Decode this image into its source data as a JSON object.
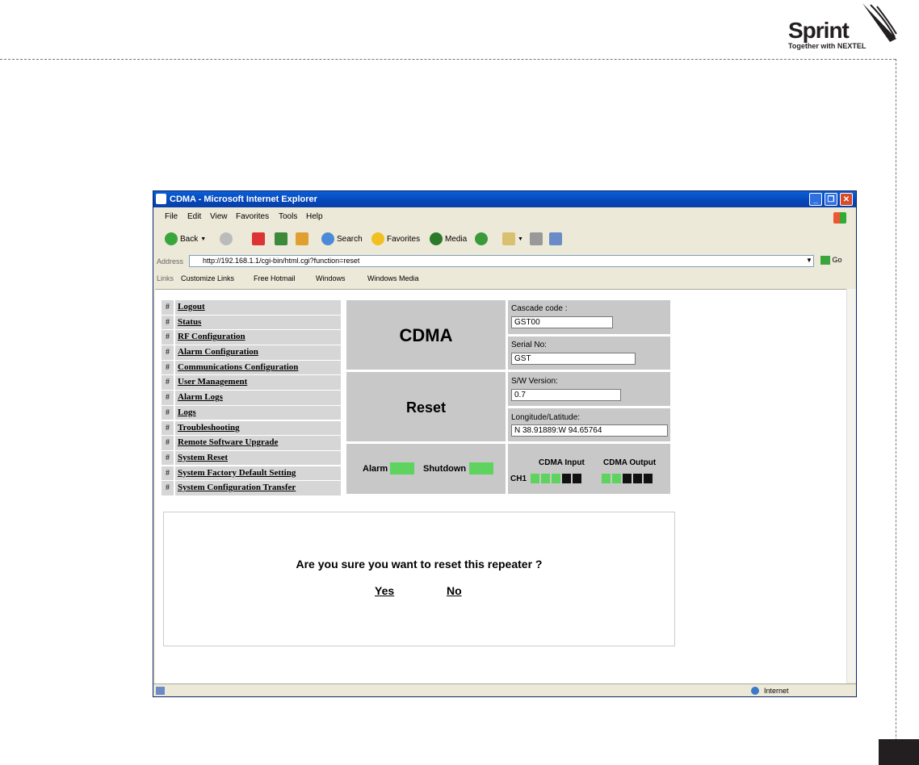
{
  "logo": {
    "brand": "Sprint",
    "tagline": "Together with NEXTEL"
  },
  "window": {
    "title": "CDMA - Microsoft Internet Explorer"
  },
  "menu": {
    "items": [
      "File",
      "Edit",
      "View",
      "Favorites",
      "Tools",
      "Help"
    ]
  },
  "toolbar": {
    "back": "Back",
    "search": "Search",
    "favorites": "Favorites",
    "media": "Media"
  },
  "address": {
    "label": "Address",
    "url": "http://192.168.1.1/cgi-bin/html.cgi?function=reset",
    "go": "Go"
  },
  "links": {
    "label": "Links",
    "items": [
      "Customize Links",
      "Free Hotmail",
      "Windows",
      "Windows Media"
    ]
  },
  "nav": {
    "hash": "#",
    "items": [
      "Logout",
      "Status",
      "RF Configuration",
      "Alarm Configuration",
      "Communications Configuration",
      "User Management",
      "Alarm Logs",
      "Logs",
      "Troubleshooting",
      "Remote Software Upgrade",
      "System Reset",
      "System Factory Default Setting",
      "System Configuration Transfer"
    ]
  },
  "device": {
    "title": "CDMA",
    "page": "Reset",
    "cascade_label": "Cascade code :",
    "cascade_value": "GST00",
    "serial_label": "Serial No:",
    "serial_value": "GST",
    "sw_label": "S/W Version:",
    "sw_value": "0.7",
    "geo_label": "Longitude/Latitude:",
    "geo_value": "N 38.91889:W 94.65764"
  },
  "status": {
    "alarm_label": "Alarm",
    "shutdown_label": "Shutdown",
    "cdma_input_label": "CDMA Input",
    "cdma_output_label": "CDMA Output",
    "channel": "CH1",
    "led_on_color": "#5fd35f",
    "led_off_color": "#111111"
  },
  "confirm": {
    "question": "Are you sure you want to reset this repeater ?",
    "yes": "Yes",
    "no": "No"
  },
  "statusbar": {
    "zone": "Internet"
  }
}
